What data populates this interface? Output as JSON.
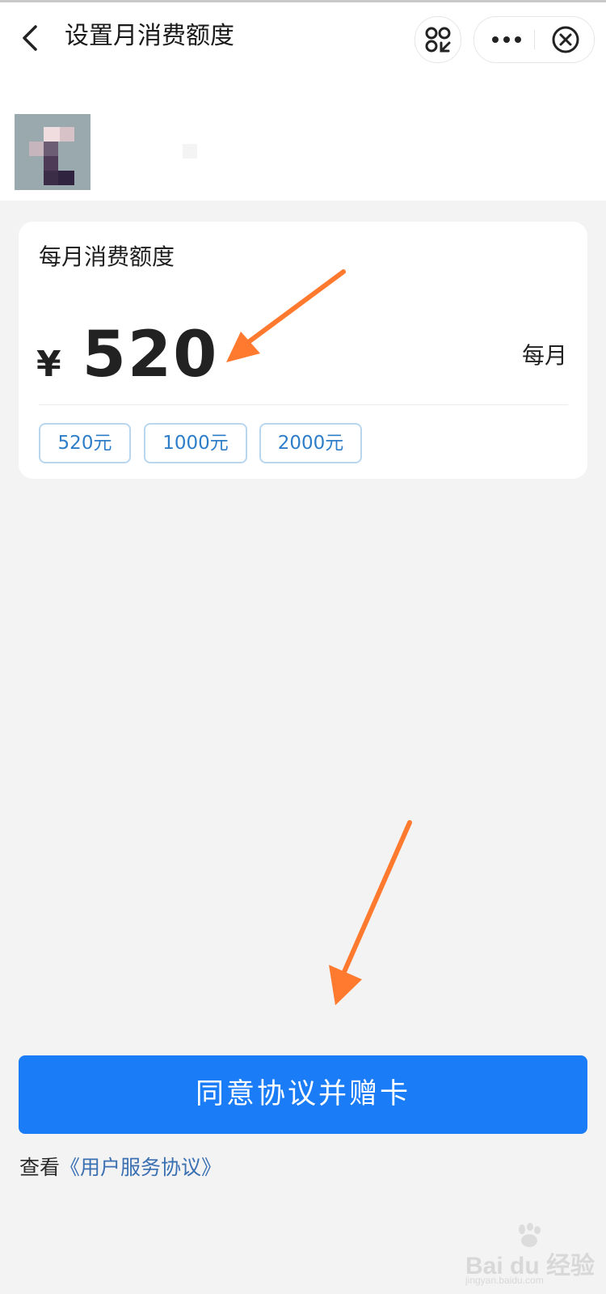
{
  "header": {
    "title": "设置月消费额度",
    "back_icon": "chevron-left-icon",
    "miniprogram_icon": "switch-miniprogram-icon",
    "more_icon": "more-dots-icon",
    "close_icon": "close-circle-icon"
  },
  "card": {
    "label": "每月消费额度",
    "currency": "¥",
    "amount": "520",
    "period": "每月",
    "options": [
      "520元",
      "1000元",
      "2000元"
    ]
  },
  "footer": {
    "agree_button": "同意协议并赠卡",
    "view_prefix": "查看",
    "agreement_link": "《用户服务协议》"
  },
  "watermark": {
    "brand": "Bai du 经验",
    "url": "jingyan.baidu.com"
  },
  "colors": {
    "primary": "#1b7cf7",
    "chip_text": "#2d7dc9",
    "chip_border": "#b8d7ef",
    "annotation_arrow": "#ff7a2f",
    "page_bg": "#f3f3f3"
  }
}
